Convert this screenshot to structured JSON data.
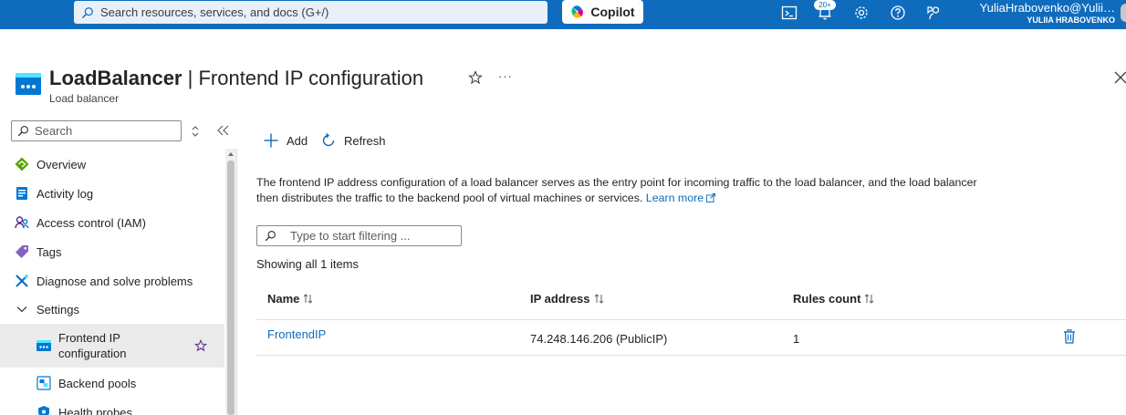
{
  "topbar": {
    "search_placeholder": "Search resources, services, and docs (G+/)",
    "copilot_label": "Copilot",
    "notification_badge": "20+",
    "user_name": "YuliaHrabovenko@Yulii…",
    "user_tenant": "YULIIA HRABOVENKO",
    "icons": [
      "cloud-shell-icon",
      "notifications-icon",
      "settings-icon",
      "help-icon",
      "feedback-icon"
    ]
  },
  "header": {
    "resource_name": "LoadBalancer",
    "separator": " | ",
    "blade_title": "Frontend IP configuration",
    "resource_type": "Load balancer",
    "more": "···"
  },
  "sidebar": {
    "search_placeholder": "Search",
    "items": [
      {
        "label": "Overview",
        "icon": "overview-icon"
      },
      {
        "label": "Activity log",
        "icon": "activity-log-icon"
      },
      {
        "label": "Access control (IAM)",
        "icon": "iam-icon"
      },
      {
        "label": "Tags",
        "icon": "tag-icon"
      },
      {
        "label": "Diagnose and solve problems",
        "icon": "diagnose-icon"
      },
      {
        "label": "Settings",
        "icon": "chevron-down-icon"
      },
      {
        "label": "Frontend IP configuration",
        "label_line1": "Frontend IP",
        "label_line2": "configuration",
        "icon": "frontend-ip-icon",
        "selected": true
      },
      {
        "label": "Backend pools",
        "icon": "backend-pools-icon"
      },
      {
        "label": "Health probes",
        "icon": "health-probes-icon"
      }
    ]
  },
  "toolbar": {
    "add_label": "Add",
    "refresh_label": "Refresh"
  },
  "main": {
    "description": "The frontend IP address configuration of a load balancer serves as the entry point for incoming traffic to the load balancer, and the load balancer then distributes the traffic to the backend pool of virtual machines or services.",
    "learn_more": "Learn more",
    "filter_placeholder": "Type to start filtering ...",
    "count_text": "Showing all 1 items"
  },
  "table": {
    "columns": [
      "Name",
      "IP address",
      "Rules count"
    ],
    "rows": [
      {
        "name": "FrontendIP",
        "ip_address": "74.248.146.206 (PublicIP)",
        "rules_count": "1"
      }
    ]
  },
  "colors": {
    "topbar": "#0f6cbd",
    "link": "#0f6cbd",
    "selected_bg": "#ebebeb"
  }
}
